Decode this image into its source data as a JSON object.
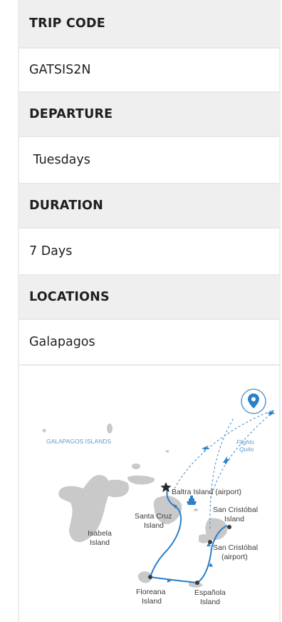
{
  "details": [
    {
      "label": "TRIP CODE",
      "value": "GATSIS2N"
    },
    {
      "label": "DEPARTURE",
      "value": " Tuesdays"
    },
    {
      "label": "DURATION",
      "value": "7 Days"
    },
    {
      "label": "LOCATIONS",
      "value": "Galapagos"
    }
  ],
  "map": {
    "title": "GALAPAGOS ISLANDS",
    "flights_line1": "Flights",
    "flights_line2": "Quito",
    "labels": {
      "baltra": "Baltra Island (airport)",
      "santa_cruz_1": "Santa Cruz",
      "santa_cruz_2": "Island",
      "san_cristobal_1": "San Cristóbal",
      "san_cristobal_2": "Island",
      "isabela_1": "Isabela",
      "isabela_2": "Island",
      "san_cristobal_airport_1": "San Cristóbal",
      "san_cristobal_airport_2": "(airport)",
      "floreana_1": "Floreana",
      "floreana_2": "Island",
      "espanola_1": "Española",
      "espanola_2": "Island"
    },
    "route_color": "#2a7fc9",
    "land_color": "#c8c8c8"
  }
}
